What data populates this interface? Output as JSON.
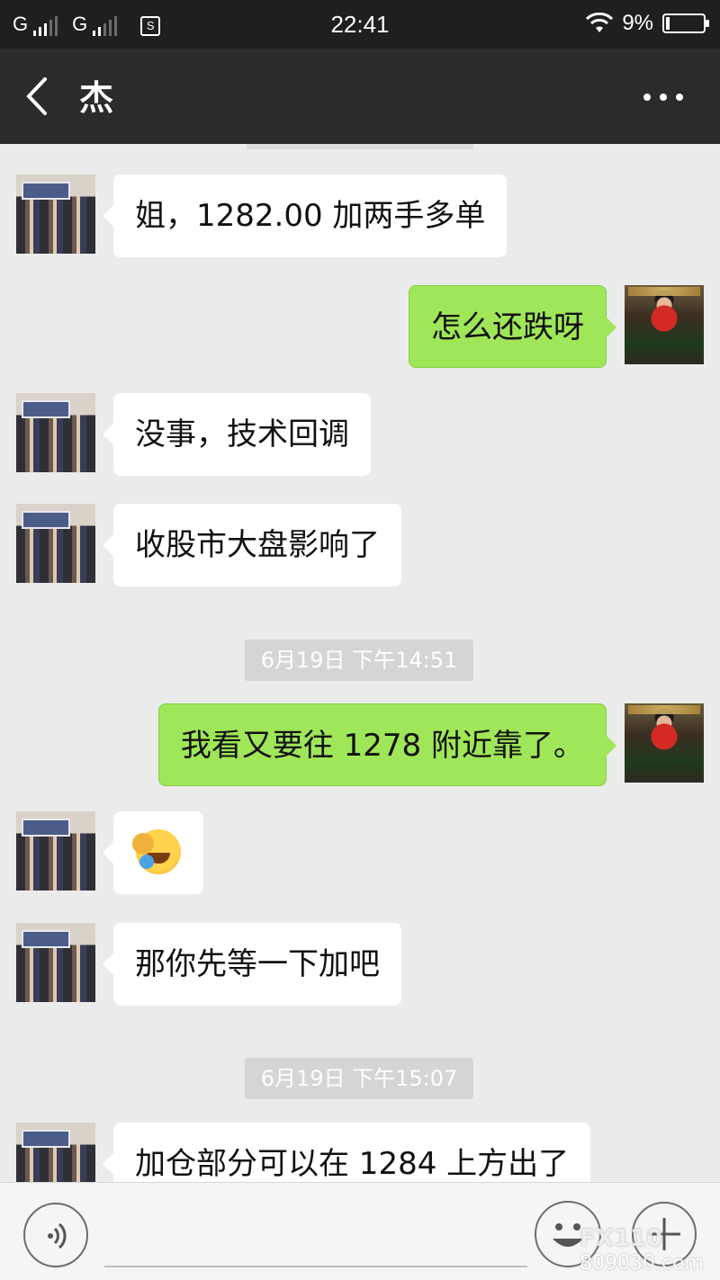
{
  "status_bar": {
    "carrier1": "G",
    "carrier2": "G",
    "sim_badge": "S",
    "time": "22:41",
    "battery_percent": "9%",
    "battery_level": 0.09
  },
  "header": {
    "title": "杰"
  },
  "messages": [
    {
      "type": "text",
      "side": "left",
      "text": "姐，1282.00 加两手多单"
    },
    {
      "type": "text",
      "side": "right",
      "text": "怎么还跌呀"
    },
    {
      "type": "text",
      "side": "left",
      "text": "没事，技术回调"
    },
    {
      "type": "text",
      "side": "left",
      "text": "收股市大盘影响了"
    },
    {
      "type": "timestamp",
      "text": "6月19日  下午14:51"
    },
    {
      "type": "text",
      "side": "right",
      "text": "我看又要往 1278 附近靠了。"
    },
    {
      "type": "emoji",
      "side": "left",
      "icon": "laugh-cry-facepalm-emoji"
    },
    {
      "type": "text",
      "side": "left",
      "text": "那你先等一下加吧"
    },
    {
      "type": "timestamp",
      "text": "6月19日  下午15:07"
    },
    {
      "type": "text",
      "side": "left",
      "text": "加仓部分可以在 1284 上方出了"
    }
  ],
  "input_bar": {
    "placeholder": ""
  },
  "watermark": {
    "brand": "FX110",
    "url": "809030.com"
  }
}
